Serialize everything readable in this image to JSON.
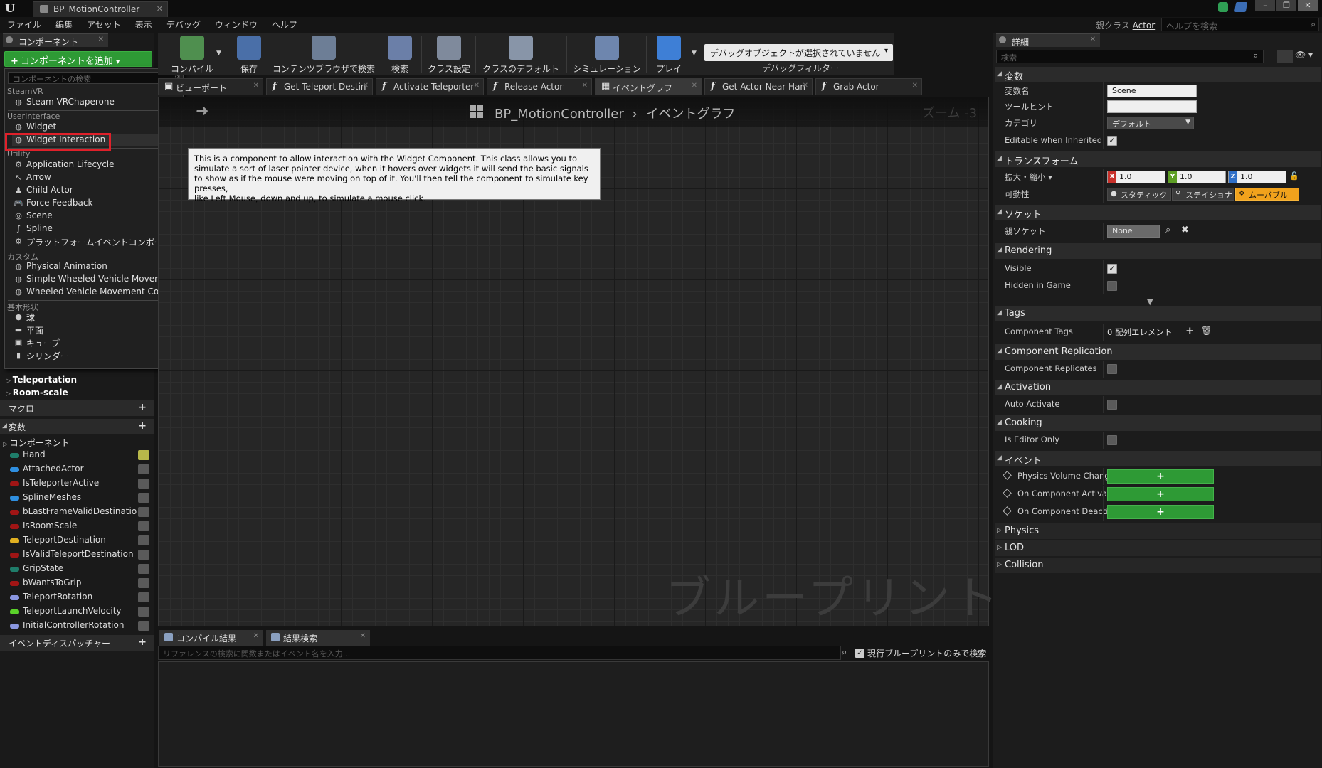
{
  "window": {
    "tab_title": "BP_MotionController",
    "parent_class_label": "親クラス",
    "parent_class_value": "Actor",
    "help_search_placeholder": "ヘルプを検索",
    "controls": [
      "–",
      "❐",
      "✕"
    ]
  },
  "menu": [
    "ファイル",
    "編集",
    "アセット",
    "表示",
    "デバッグ",
    "ウィンドウ",
    "ヘルプ"
  ],
  "components_panel": {
    "tab_label": "コンポーネント",
    "add_button": "コンポーネントを追加",
    "dropdown": {
      "search_placeholder": "コンポーネントの検索",
      "groups": [
        {
          "category": "SteamVR",
          "items": [
            {
              "label": "Steam VRChaperone",
              "icon": "sphere-icon"
            }
          ]
        },
        {
          "category": "UserInterface",
          "items": [
            {
              "label": "Widget",
              "icon": "sphere-icon"
            },
            {
              "label": "Widget Interaction",
              "icon": "sphere-icon",
              "selected": true
            }
          ]
        },
        {
          "category": "Utility",
          "items": [
            {
              "label": "Application Lifecycle",
              "icon": "gear-icon"
            },
            {
              "label": "Arrow",
              "icon": "arrow-icon"
            },
            {
              "label": "Child Actor",
              "icon": "child-actor-icon"
            },
            {
              "label": "Force Feedback",
              "icon": "gamepad-icon"
            },
            {
              "label": "Scene",
              "icon": "scene-icon"
            },
            {
              "label": "Spline",
              "icon": "spline-icon"
            },
            {
              "label": "プラットフォームイベントコンポーネ",
              "icon": "gear-icon"
            }
          ]
        },
        {
          "category": "カスタム",
          "items": [
            {
              "label": "Physical Animation",
              "icon": "sphere-icon"
            },
            {
              "label": "Simple Wheeled Vehicle Movement",
              "icon": "sphere-icon"
            },
            {
              "label": "Wheeled Vehicle Movement Componer",
              "icon": "sphere-icon"
            }
          ]
        },
        {
          "category": "基本形状",
          "items": [
            {
              "label": "球",
              "icon": "sphere-shape-icon"
            },
            {
              "label": "平面",
              "icon": "plane-shape-icon"
            },
            {
              "label": "キューブ",
              "icon": "cube-shape-icon"
            },
            {
              "label": "シリンダー",
              "icon": "cylinder-shape-icon"
            }
          ]
        }
      ]
    },
    "tree": [
      "Teleportation",
      "Room-scale"
    ]
  },
  "my_blueprint": {
    "macro_header": "マクロ",
    "variables_header": "変数",
    "components_group": "コンポーネント",
    "variables": [
      {
        "name": "Hand",
        "color": "#1f7d6a"
      },
      {
        "name": "AttachedActor",
        "color": "#2f8fe0"
      },
      {
        "name": "IsTeleporterActive",
        "color": "#a01515"
      },
      {
        "name": "SplineMeshes",
        "color": "#2f8fe0"
      },
      {
        "name": "bLastFrameValidDestinatio",
        "color": "#a01515"
      },
      {
        "name": "IsRoomScale",
        "color": "#a01515"
      },
      {
        "name": "TeleportDestination",
        "color": "#e0b021"
      },
      {
        "name": "IsValidTeleportDestination",
        "color": "#a01515"
      },
      {
        "name": "GripState",
        "color": "#1f7d6a"
      },
      {
        "name": "bWantsToGrip",
        "color": "#a01515"
      },
      {
        "name": "TeleportRotation",
        "color": "#8a96e0"
      },
      {
        "name": "TeleportLaunchVelocity",
        "color": "#5bd22a"
      },
      {
        "name": "InitialControllerRotation",
        "color": "#8a96e0"
      }
    ],
    "dispatchers_header": "イベントディスパッチャー"
  },
  "toolbar": {
    "buttons": [
      {
        "label": "コンパイル",
        "icon": "compile-icon"
      },
      {
        "label": "保存",
        "icon": "save-icon"
      },
      {
        "label": "コンテンツブラウザで検索",
        "icon": "browse-icon"
      },
      {
        "label": "検索",
        "icon": "find-icon"
      },
      {
        "label": "クラス設定",
        "icon": "class-settings-icon"
      },
      {
        "label": "クラスのデフォルト",
        "icon": "class-defaults-icon"
      },
      {
        "label": "シミュレーション",
        "icon": "simulation-icon"
      },
      {
        "label": "プレイ",
        "icon": "play-icon"
      }
    ],
    "debug_object": "デバッグオブジェクトが選択されていません",
    "debug_filter": "デバッグフィルター"
  },
  "graph_tabs": [
    {
      "label": "ビューポート",
      "icon": "viewport-icon"
    },
    {
      "label": "Get Teleport Destin",
      "icon": "function-icon"
    },
    {
      "label": "Activate Teleporter",
      "icon": "function-icon"
    },
    {
      "label": "Release Actor",
      "icon": "function-icon"
    },
    {
      "label": "イベントグラフ",
      "icon": "event-graph-icon",
      "active": true
    },
    {
      "label": "Get Actor Near Han",
      "icon": "function-icon"
    },
    {
      "label": "Grab Actor",
      "icon": "function-icon"
    }
  ],
  "graph": {
    "breadcrumb_blueprint": "BP_MotionController",
    "breadcrumb_separator": "›",
    "breadcrumb_graph": "イベントグラフ",
    "zoom": "ズーム -3",
    "watermark": "ブループリント",
    "tooltip_lines": [
      "This is a component to allow interaction with the Widget Component.  This class allows you to",
      "simulate a sort of laser pointer device, when it hovers over widgets it will send the basic signals",
      "to show as if the mouse were moving on top of it.  You'll then tell the component to simulate key presses,",
      "like Left Mouse, down and up, to simulate a mouse click."
    ]
  },
  "bottom": {
    "tabs": [
      "コンパイル結果",
      "結果検索"
    ],
    "search_placeholder": "リファレンスの検索に関数またはイベント名を入力...",
    "checkbox_label": "現行ブループリントのみで検索"
  },
  "details": {
    "tab_label": "詳細",
    "search_placeholder": "検索",
    "variable": {
      "header": "変数",
      "name_label": "変数名",
      "name_value": "Scene",
      "tooltip_label": "ツールヒント",
      "tooltip_value": "",
      "category_label": "カテゴリ",
      "category_value": "デフォルト",
      "editable_label": "Editable when Inherited"
    },
    "transform": {
      "header": "トランスフォーム",
      "scale_label": "拡大・縮小 ▾",
      "scale": {
        "x": "1.0",
        "y": "1.0",
        "z": "1.0"
      },
      "axis_colors": {
        "x": "#c8302a",
        "y": "#5d9e24",
        "z": "#2f6fc8"
      },
      "mobility_label": "可動性",
      "mobility": [
        "スタティック",
        "ステイショナリ",
        "ムーバブル"
      ]
    },
    "sockets": {
      "header": "ソケット",
      "parent_label": "親ソケット",
      "parent_value": "None"
    },
    "rendering": {
      "header": "Rendering",
      "visible_label": "Visible",
      "hidden_label": "Hidden in Game"
    },
    "tags": {
      "header": "Tags",
      "label": "Component Tags",
      "value": "0 配列エレメント"
    },
    "replication": {
      "header": "Component Replication",
      "label": "Component Replicates"
    },
    "activation": {
      "header": "Activation",
      "label": "Auto Activate"
    },
    "cooking": {
      "header": "Cooking",
      "label": "Is Editor Only"
    },
    "events": {
      "header": "イベント",
      "items": [
        "Physics Volume Chang",
        "On Component Activate",
        "On Component Deactiv"
      ]
    },
    "collapsed": [
      "Physics",
      "LOD",
      "Collision"
    ]
  }
}
